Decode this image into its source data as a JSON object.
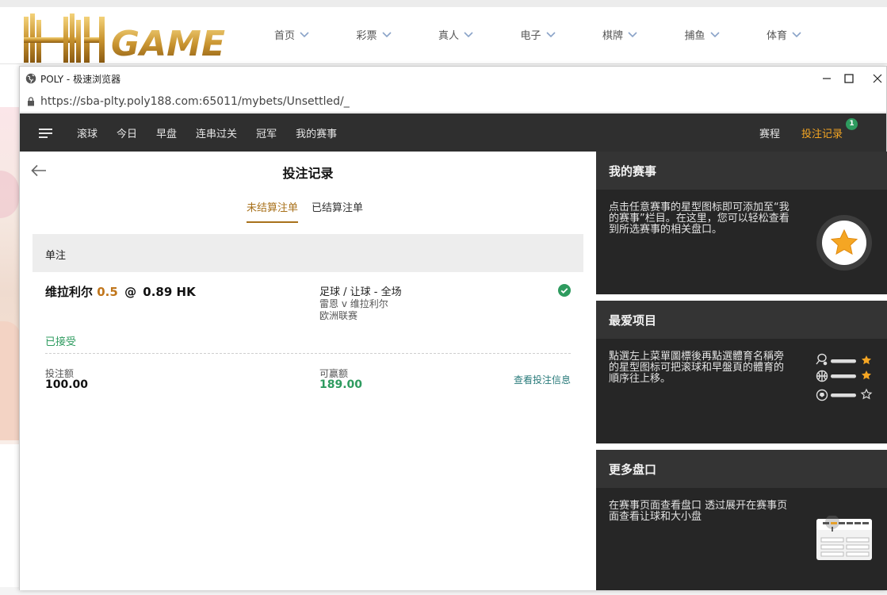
{
  "site": {
    "logo_text": "HH GAME",
    "nav": [
      {
        "label": "首页"
      },
      {
        "label": "彩票"
      },
      {
        "label": "真人"
      },
      {
        "label": "电子"
      },
      {
        "label": "棋牌"
      },
      {
        "label": "捕鱼"
      },
      {
        "label": "体育"
      }
    ]
  },
  "browser": {
    "title": "POLY - 极速浏览器",
    "url": "https://sba-plty.poly188.com:65011/mybets/Unsettled/_"
  },
  "app_nav": {
    "items": [
      "滚球",
      "今日",
      "早盘",
      "连串过关",
      "冠军",
      "我的赛事"
    ],
    "schedule": "赛程",
    "bet_record": "投注记录",
    "badge_count": "1"
  },
  "bets_page": {
    "title": "投注记录",
    "tabs": [
      {
        "label": "未结算注单",
        "active": true
      },
      {
        "label": "已结算注单",
        "active": false
      }
    ],
    "section_label": "单注",
    "bet": {
      "selection": "维拉利尔",
      "handicap": "0.5",
      "at": "@",
      "odds": "0.89 HK",
      "market": "足球 / 让球 - 全场",
      "match": "雷恩 v 维拉利尔",
      "league": "欧洲联赛",
      "status": "已接受",
      "stake_label": "投注额",
      "stake_value": "100.00",
      "win_label": "可赢额",
      "win_value": "189.00",
      "view_info": "查看投注信息"
    }
  },
  "sidebar": {
    "cards": [
      {
        "title": "我的赛事",
        "text_lines": [
          "点击任意赛事的星型图标即可添加至“我",
          "的赛事”栏目。在这里，您可以轻松查看",
          "到所选赛事的相关盘口。"
        ]
      },
      {
        "title": "最爱项目",
        "text_lines": [
          "點選左上菜單圖標後再點選體育名稱旁",
          "的星型图标可把滚球和早盤頁的體育的",
          "順序往上移。"
        ]
      },
      {
        "title": "更多盘口",
        "text_lines": [
          "在赛事页面查看盘口 透过展开在赛事页",
          "面查看让球和大小盘"
        ]
      }
    ]
  },
  "colors": {
    "accent_orange": "#f5a623",
    "gold_tab": "#a8711b",
    "green_status": "#2e9b5f",
    "nav_bg": "#2f2f2f",
    "card_bg": "#262626"
  }
}
